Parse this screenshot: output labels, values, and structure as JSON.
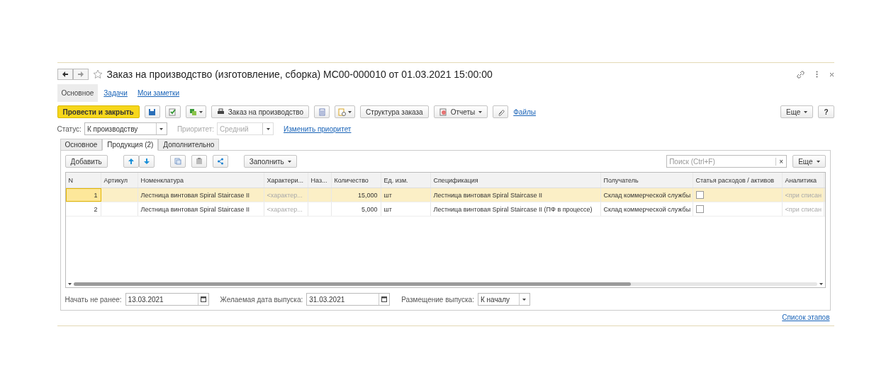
{
  "window": {
    "title": "Заказ на производство (изготовление, сборка) МС00-000010 от 01.03.2021 15:00:00"
  },
  "nav_tabs": [
    {
      "label": "Основное",
      "selected": true
    },
    {
      "label": "Задачи",
      "selected": false
    },
    {
      "label": "Мои заметки",
      "selected": false
    }
  ],
  "toolbar": [
    {
      "kind": "primary",
      "label": "Провести и закрыть"
    },
    {
      "kind": "icon"
    },
    {
      "kind": "icon"
    },
    {
      "kind": "icon_menu"
    },
    {
      "kind": "button",
      "label": "Заказ на производство"
    },
    {
      "kind": "icon"
    },
    {
      "kind": "icon_menu"
    },
    {
      "kind": "button",
      "label": "Структура заказа"
    },
    {
      "kind": "menu",
      "label": "Отчеты"
    },
    {
      "kind": "icon"
    },
    {
      "kind": "link",
      "label": "Файлы"
    }
  ],
  "toolbar_right": {
    "more": "Еще",
    "help": "?"
  },
  "status": {
    "label": "Статус:",
    "value": "К производству",
    "priority_label": "Приоритет:",
    "priority_value": "Средний",
    "priority_disabled": true,
    "change_link": "Изменить приоритет"
  },
  "tabs": [
    {
      "label": "Основное",
      "selected": false
    },
    {
      "label": "Продукция (2)",
      "selected": true
    },
    {
      "label": "Дополнительно",
      "selected": false
    }
  ],
  "table_toolbar": {
    "add": "Добавить",
    "fill": "Заполнить",
    "search_placeholder": "Поиск (Ctrl+F)",
    "clear": "×",
    "more": "Еще"
  },
  "table": {
    "columns": [
      "N",
      "Артикул",
      "Номенклатура",
      "Характери...",
      "Наз...",
      "Количество",
      "Ед. изм.",
      "Спецификация",
      "Получатель",
      "Статья расходов / активов",
      "Аналитика"
    ],
    "rows": [
      {
        "selected": true,
        "n": "1",
        "article": "",
        "item": "Лестница винтовая Spiral Staircase II",
        "characteristic": "<характер...",
        "purpose": "",
        "quantity": "15,000",
        "unit": "шт",
        "specification": "Лестница винтовая Spiral Staircase II",
        "recipient": "Склад коммерческой службы",
        "expense_checked": false,
        "analytics": "<при списан"
      },
      {
        "selected": false,
        "n": "2",
        "article": "",
        "item": "Лестница винтовая Spiral Staircase II",
        "characteristic": "<характер...",
        "purpose": "",
        "quantity": "5,000",
        "unit": "шт",
        "specification": "Лестница винтовая Spiral Staircase II (ПФ в процессе)",
        "recipient": "Склад коммерческой службы",
        "expense_checked": false,
        "analytics": "<при списан"
      }
    ]
  },
  "bottom_fields": [
    {
      "kind": "date",
      "label": "Начать не ранее:",
      "value": "13.03.2021"
    },
    {
      "kind": "date",
      "label": "Желаемая дата выпуска:",
      "value": "31.03.2021"
    },
    {
      "kind": "select",
      "label": "Размещение выпуска:",
      "value": "К началу"
    }
  ],
  "footer_link": "Список этапов"
}
